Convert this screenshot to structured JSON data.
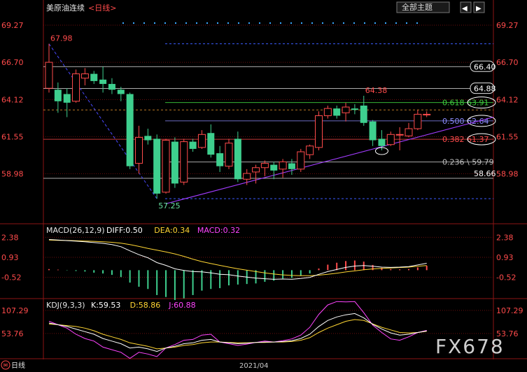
{
  "header": {
    "instrument": "美原油连续",
    "period": "<日线>",
    "theme_button": "全部主题",
    "nav_left": "◀",
    "nav_right": "▶"
  },
  "chart_data": [
    {
      "type": "candlestick",
      "panel": "price",
      "yticks": [
        "69.27",
        "66.70",
        "64.12",
        "61.55",
        "58.98"
      ],
      "ylim": [
        55.9,
        69.95
      ],
      "candles": [
        {
          "o": 64.9,
          "h": 67.98,
          "l": 64.6,
          "c": 66.7
        },
        {
          "o": 64.8,
          "h": 65.3,
          "l": 63.2,
          "c": 64.0
        },
        {
          "o": 64.5,
          "h": 64.9,
          "l": 62.9,
          "c": 63.9
        },
        {
          "o": 64.0,
          "h": 66.2,
          "l": 63.9,
          "c": 65.9
        },
        {
          "o": 65.6,
          "h": 66.3,
          "l": 65.1,
          "c": 65.9
        },
        {
          "o": 65.9,
          "h": 66.1,
          "l": 65.2,
          "c": 65.4
        },
        {
          "o": 65.5,
          "h": 66.4,
          "l": 64.6,
          "c": 65.2
        },
        {
          "o": 65.2,
          "h": 65.6,
          "l": 64.5,
          "c": 64.8
        },
        {
          "o": 64.8,
          "h": 65.0,
          "l": 64.0,
          "c": 64.5
        },
        {
          "o": 64.5,
          "h": 64.6,
          "l": 59.3,
          "c": 59.5
        },
        {
          "o": 59.7,
          "h": 62.3,
          "l": 59.0,
          "c": 61.5
        },
        {
          "o": 61.6,
          "h": 62.1,
          "l": 61.0,
          "c": 61.3
        },
        {
          "o": 61.4,
          "h": 61.7,
          "l": 57.25,
          "c": 57.6
        },
        {
          "o": 57.7,
          "h": 61.4,
          "l": 57.6,
          "c": 61.3
        },
        {
          "o": 61.2,
          "h": 61.5,
          "l": 58.0,
          "c": 58.3
        },
        {
          "o": 58.4,
          "h": 61.4,
          "l": 58.2,
          "c": 61.2
        },
        {
          "o": 61.2,
          "h": 61.4,
          "l": 60.5,
          "c": 60.7
        },
        {
          "o": 60.8,
          "h": 62.0,
          "l": 60.7,
          "c": 61.7
        },
        {
          "o": 61.8,
          "h": 62.4,
          "l": 60.1,
          "c": 60.3
        },
        {
          "o": 60.4,
          "h": 60.9,
          "l": 59.1,
          "c": 59.5
        },
        {
          "o": 59.5,
          "h": 61.4,
          "l": 59.3,
          "c": 61.1
        },
        {
          "o": 61.4,
          "h": 61.9,
          "l": 58.4,
          "c": 58.6
        },
        {
          "o": 58.6,
          "h": 59.3,
          "l": 58.2,
          "c": 59.0
        },
        {
          "o": 59.1,
          "h": 59.6,
          "l": 58.3,
          "c": 59.4
        },
        {
          "o": 59.4,
          "h": 59.9,
          "l": 58.8,
          "c": 59.7
        },
        {
          "o": 59.6,
          "h": 59.8,
          "l": 58.6,
          "c": 59.2
        },
        {
          "o": 59.3,
          "h": 60.0,
          "l": 58.7,
          "c": 59.8
        },
        {
          "o": 59.7,
          "h": 60.0,
          "l": 58.9,
          "c": 59.3
        },
        {
          "o": 59.3,
          "h": 60.7,
          "l": 59.1,
          "c": 60.5
        },
        {
          "o": 60.3,
          "h": 61.0,
          "l": 60.0,
          "c": 60.9
        },
        {
          "o": 60.8,
          "h": 63.3,
          "l": 60.6,
          "c": 63.0
        },
        {
          "o": 63.0,
          "h": 63.7,
          "l": 62.8,
          "c": 63.5
        },
        {
          "o": 63.5,
          "h": 63.7,
          "l": 62.8,
          "c": 63.0
        },
        {
          "o": 63.2,
          "h": 63.9,
          "l": 62.6,
          "c": 63.6
        },
        {
          "o": 63.5,
          "h": 63.8,
          "l": 63.1,
          "c": 63.4
        },
        {
          "o": 63.7,
          "h": 64.38,
          "l": 62.3,
          "c": 62.5
        },
        {
          "o": 62.6,
          "h": 62.7,
          "l": 60.9,
          "c": 61.3
        },
        {
          "o": 61.4,
          "h": 62.0,
          "l": 60.6,
          "c": 60.9
        },
        {
          "o": 61.0,
          "h": 61.9,
          "l": 60.9,
          "c": 61.7
        },
        {
          "o": 61.7,
          "h": 62.2,
          "l": 60.6,
          "c": 61.7
        },
        {
          "o": 61.6,
          "h": 62.5,
          "l": 61.5,
          "c": 62.1
        },
        {
          "o": 62.1,
          "h": 63.4,
          "l": 62.0,
          "c": 63.1
        },
        {
          "o": 63.1,
          "h": 63.3,
          "l": 62.9,
          "c": 63.1
        }
      ],
      "annotations": [
        {
          "text": "67.98",
          "color": "#ff4b4b"
        },
        {
          "text": "57.25",
          "color": "#66e0a0"
        },
        {
          "text": "64.38",
          "color": "#ff4b4b"
        }
      ],
      "hlines": [
        {
          "label": "66.40",
          "value": 66.4
        },
        {
          "label": "64.88",
          "value": 64.88
        },
        {
          "label": "58.66",
          "value": 58.66
        }
      ],
      "fibonacci": [
        {
          "ratio": "0.618",
          "value": "63.91",
          "color": "#3ecf3e"
        },
        {
          "ratio": "0.500",
          "value": "62.64",
          "color": "#8d8dff"
        },
        {
          "ratio": "0.382",
          "value": "61.37",
          "color": "#ff4b4b"
        },
        {
          "ratio": "0.236",
          "value": "59.79",
          "color": "#bfbfbf"
        }
      ]
    },
    {
      "type": "line",
      "panel": "macd",
      "title": "MACD(26,12,9)",
      "legend": [
        {
          "label": "DIFF:0.50",
          "color": "#ffffff"
        },
        {
          "label": "DEA:0.34",
          "color": "#ffd633"
        },
        {
          "label": "MACD:0.32",
          "color": "#ff44ff"
        }
      ],
      "yticks": [
        "2.38",
        "0.93",
        "-0.52"
      ],
      "ylim": [
        -1.6,
        2.6
      ],
      "diff": [
        2.22,
        2.18,
        2.14,
        2.1,
        2.06,
        2.0,
        1.94,
        1.85,
        1.7,
        1.4,
        1.12,
        0.9,
        0.55,
        0.35,
        0.1,
        -0.02,
        -0.1,
        -0.12,
        -0.2,
        -0.3,
        -0.33,
        -0.42,
        -0.5,
        -0.58,
        -0.62,
        -0.66,
        -0.64,
        -0.66,
        -0.6,
        -0.52,
        -0.3,
        -0.1,
        0.05,
        0.2,
        0.3,
        0.34,
        0.28,
        0.22,
        0.2,
        0.22,
        0.26,
        0.38,
        0.5
      ],
      "dea": [
        2.18,
        2.16,
        2.15,
        2.13,
        2.11,
        2.09,
        2.06,
        2.02,
        1.95,
        1.85,
        1.72,
        1.58,
        1.45,
        1.32,
        1.18,
        1.0,
        0.8,
        0.62,
        0.48,
        0.35,
        0.22,
        0.1,
        0.0,
        -0.1,
        -0.2,
        -0.28,
        -0.34,
        -0.38,
        -0.4,
        -0.4,
        -0.36,
        -0.3,
        -0.22,
        -0.13,
        -0.05,
        0.03,
        0.09,
        0.13,
        0.16,
        0.19,
        0.22,
        0.28,
        0.34
      ],
      "macd": [
        0.08,
        0.04,
        -0.02,
        -0.06,
        -0.1,
        -0.18,
        -0.24,
        -0.34,
        -0.5,
        -0.9,
        -1.2,
        -1.36,
        -1.8,
        -1.94,
        -2.16,
        -2.04,
        -1.8,
        -1.48,
        -1.36,
        -1.3,
        -1.1,
        -1.04,
        -1.0,
        -0.96,
        -0.84,
        -0.76,
        -0.6,
        -0.56,
        -0.4,
        -0.24,
        0.12,
        0.4,
        0.54,
        0.66,
        0.7,
        0.62,
        0.38,
        0.18,
        0.08,
        0.06,
        0.08,
        0.2,
        0.32
      ]
    },
    {
      "type": "line",
      "panel": "kdj",
      "title": "KDJ(9,3,3)",
      "legend": [
        {
          "label": "K:59.53",
          "color": "#ffffff"
        },
        {
          "label": "D:58.86",
          "color": "#ffd633"
        },
        {
          "label": "J:60.88",
          "color": "#ff44ff"
        }
      ],
      "yticks": [
        "107.29",
        "53.76"
      ],
      "ylim": [
        0.0,
        125.0
      ],
      "k": [
        78,
        74,
        70,
        64,
        58,
        52,
        42,
        36,
        30,
        20,
        22,
        18,
        12,
        20,
        24,
        30,
        32,
        38,
        40,
        34,
        32,
        30,
        31,
        33,
        34,
        34,
        35,
        37,
        42,
        52,
        70,
        84,
        92,
        97,
        100,
        90,
        75,
        64,
        55,
        50,
        52,
        56,
        59.53
      ],
      "d": [
        76,
        74,
        72,
        70,
        66,
        60,
        52,
        46,
        40,
        32,
        28,
        24,
        18,
        20,
        22,
        26,
        28,
        32,
        34,
        34,
        33,
        32,
        32,
        33,
        33,
        34,
        34,
        35,
        38,
        44,
        56,
        66,
        74,
        82,
        86,
        84,
        76,
        68,
        62,
        56,
        55,
        56,
        58.86
      ],
      "j": [
        82,
        74,
        66,
        52,
        42,
        36,
        22,
        16,
        10,
        -4,
        10,
        6,
        0,
        20,
        28,
        38,
        40,
        50,
        52,
        34,
        30,
        26,
        29,
        33,
        36,
        34,
        37,
        41,
        50,
        68,
        98,
        120,
        128,
        127,
        128,
        102,
        73,
        56,
        41,
        38,
        46,
        56,
        60.88
      ]
    }
  ],
  "xaxis": {
    "month_label": "2021/04"
  },
  "footer": {
    "period_label": "日线"
  },
  "watermark": {
    "text": "FX678"
  },
  "colors": {
    "up": "#ff4b4b",
    "down": "#3ecf8e",
    "axis_text": "#ff4b4b",
    "grid": "#7a1010",
    "background": "#000000"
  }
}
